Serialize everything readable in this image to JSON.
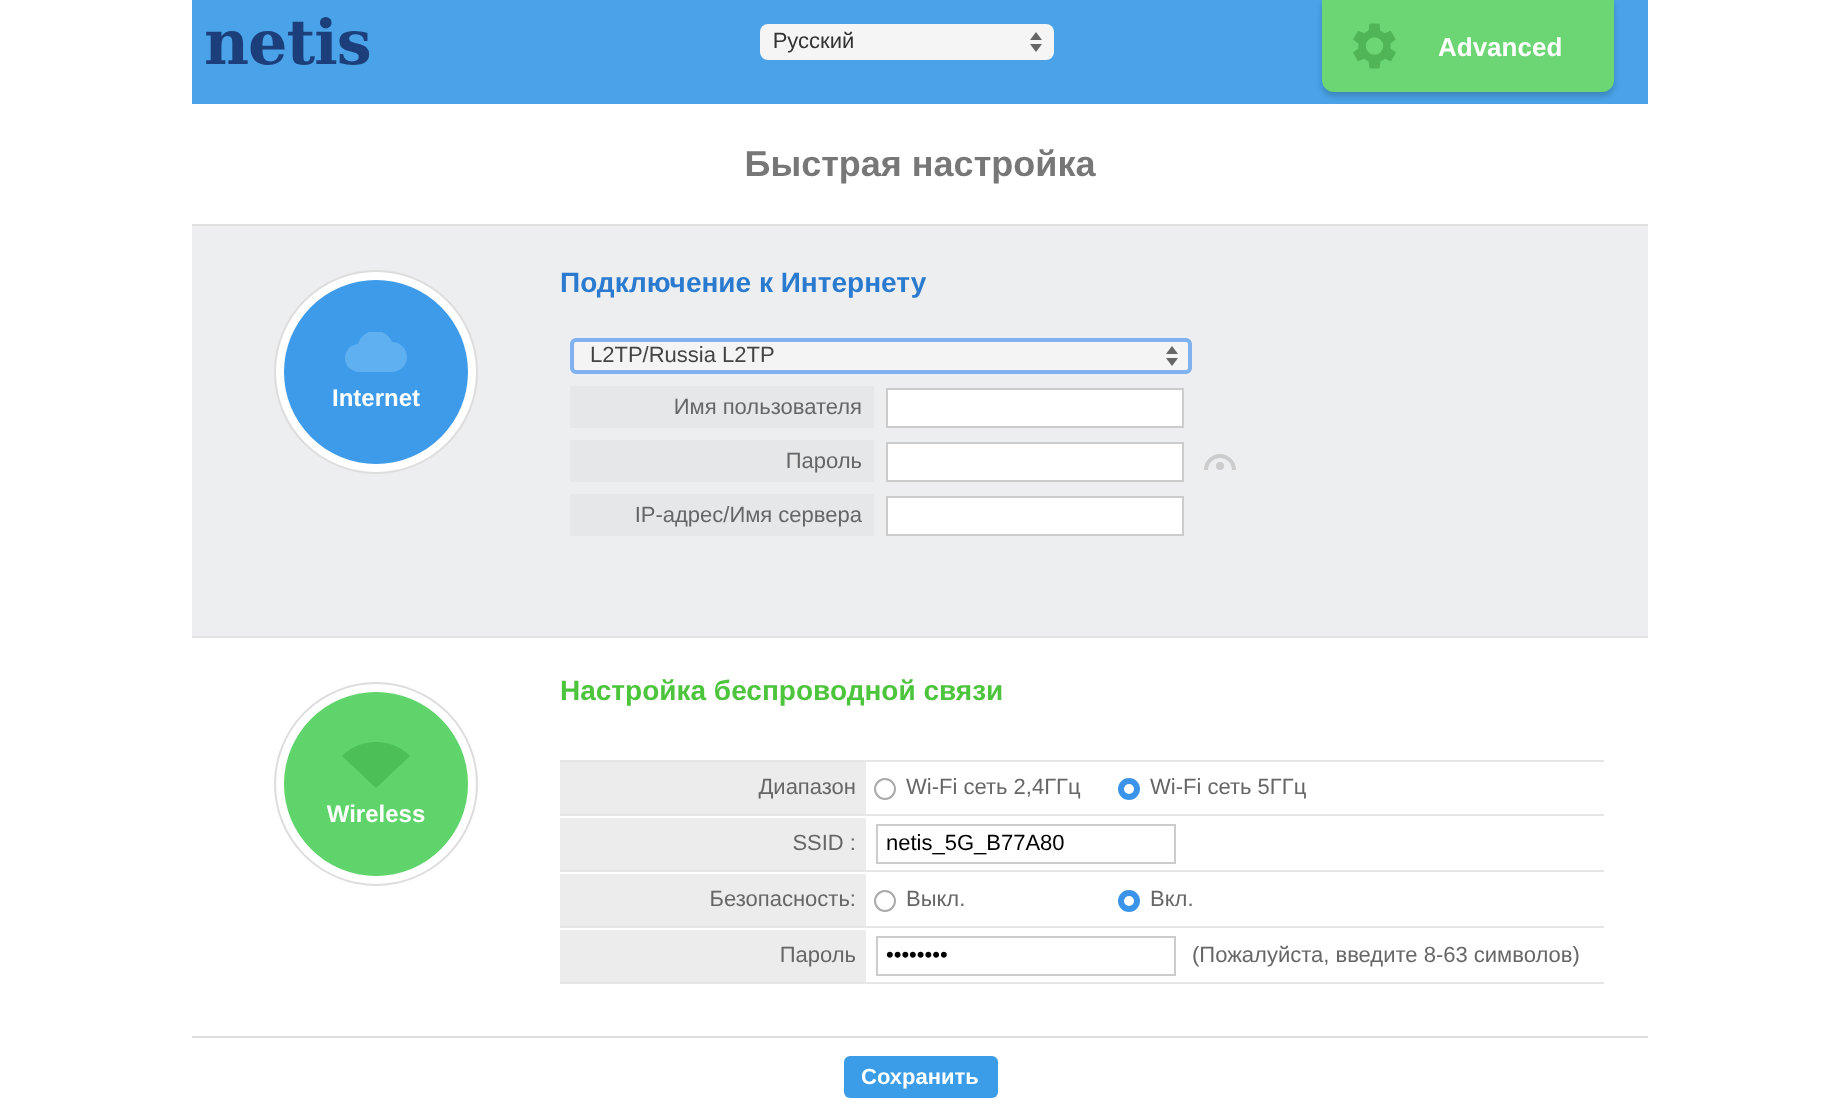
{
  "header": {
    "logo": "netis",
    "language": "Русский",
    "advanced_button": "Advanced"
  },
  "title": "Быстрая настройка",
  "internet": {
    "badge": "Internet",
    "heading": "Подключение к Интернету",
    "connection_type": "L2TP/Russia L2TP",
    "fields": [
      {
        "label": "Имя пользователя",
        "kind": "text"
      },
      {
        "label": "Пароль",
        "kind": "password"
      },
      {
        "label": "IP-адрес/Имя сервера",
        "kind": "text"
      }
    ]
  },
  "wireless": {
    "badge": "Wireless",
    "heading": "Настройка беспроводной связи",
    "rows": [
      {
        "kind": "radio",
        "label": "Диапазон",
        "options": [
          {
            "label": "Wi-Fi сеть 2,4ГГц",
            "selected": false
          },
          {
            "label": "Wi-Fi сеть 5ГГц",
            "selected": true
          }
        ]
      },
      {
        "kind": "text",
        "label": "SSID :",
        "value": "netis_5G_B77A80"
      },
      {
        "kind": "radio",
        "label": "Безопасность:",
        "options": [
          {
            "label": "Выкл.",
            "selected": false
          },
          {
            "label": "Вкл.",
            "selected": true
          }
        ]
      },
      {
        "kind": "password",
        "label": "Пароль",
        "value": "••••••••",
        "hint": "(Пожалуйста, введите 8-63 символов)"
      }
    ]
  },
  "save_button": "Сохранить"
}
